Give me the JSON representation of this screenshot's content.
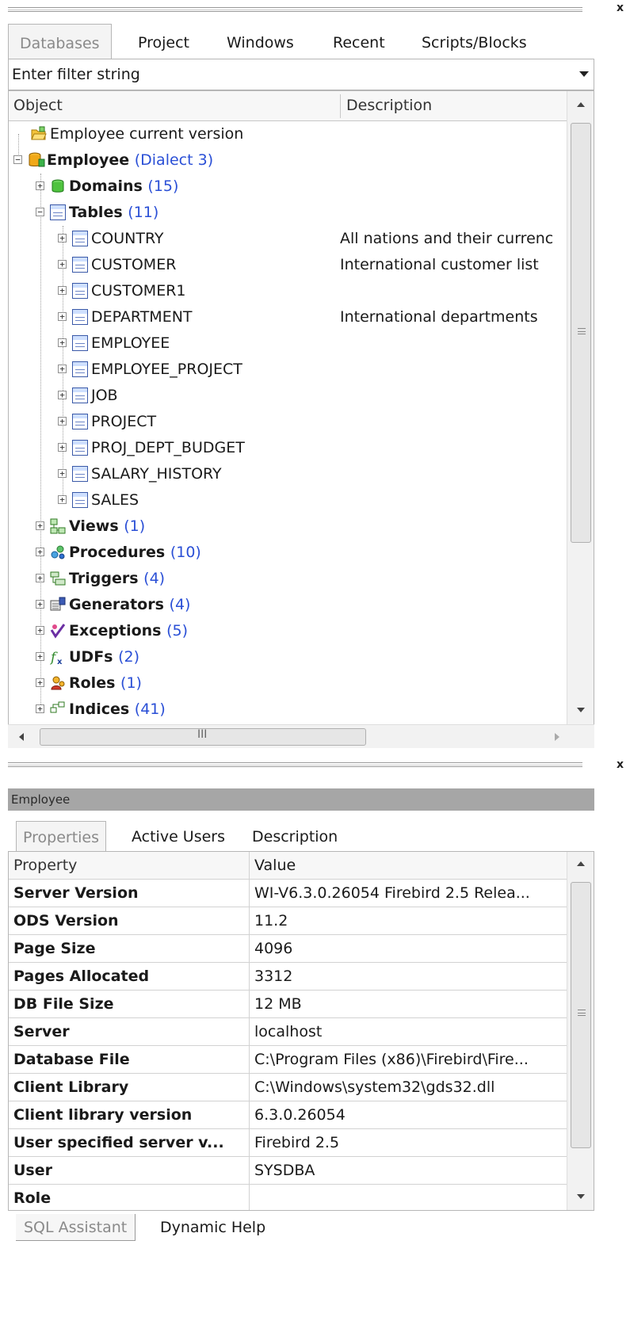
{
  "browser_tabs": [
    {
      "label": "Databases",
      "active": true
    },
    {
      "label": "Project",
      "active": false
    },
    {
      "label": "Windows",
      "active": false
    },
    {
      "label": "Recent",
      "active": false
    },
    {
      "label": "Scripts/Blocks",
      "active": false
    }
  ],
  "filter": {
    "placeholder": "Enter filter string"
  },
  "tree_header": {
    "object": "Object",
    "description": "Description"
  },
  "tree": {
    "current_version": "Employee current version",
    "database": {
      "name": "Employee",
      "dialect": "(Dialect 3)"
    },
    "domains": {
      "label": "Domains",
      "count": "(15)"
    },
    "tables": {
      "label": "Tables",
      "count": "(11)"
    },
    "table_items": [
      {
        "name": "COUNTRY",
        "description": "All nations and their currenc"
      },
      {
        "name": "CUSTOMER",
        "description": "International customer list"
      },
      {
        "name": "CUSTOMER1",
        "description": ""
      },
      {
        "name": "DEPARTMENT",
        "description": "International departments"
      },
      {
        "name": "EMPLOYEE",
        "description": ""
      },
      {
        "name": "EMPLOYEE_PROJECT",
        "description": ""
      },
      {
        "name": "JOB",
        "description": ""
      },
      {
        "name": "PROJECT",
        "description": ""
      },
      {
        "name": "PROJ_DEPT_BUDGET",
        "description": ""
      },
      {
        "name": "SALARY_HISTORY",
        "description": ""
      },
      {
        "name": "SALES",
        "description": ""
      }
    ],
    "groups": [
      {
        "label": "Views",
        "count": "(1)",
        "icon": "views-icon"
      },
      {
        "label": "Procedures",
        "count": "(10)",
        "icon": "procedures-icon"
      },
      {
        "label": "Triggers",
        "count": "(4)",
        "icon": "triggers-icon"
      },
      {
        "label": "Generators",
        "count": "(4)",
        "icon": "generators-icon"
      },
      {
        "label": "Exceptions",
        "count": "(5)",
        "icon": "exceptions-icon"
      },
      {
        "label": "UDFs",
        "count": "(2)",
        "icon": "udfs-icon"
      },
      {
        "label": "Roles",
        "count": "(1)",
        "icon": "roles-icon"
      },
      {
        "label": "Indices",
        "count": "(41)",
        "icon": "indices-icon"
      }
    ]
  },
  "hscroll_grip": "III",
  "close_glyph": "x",
  "details": {
    "title": "Employee",
    "tabs": [
      {
        "label": "Properties",
        "active": true
      },
      {
        "label": "Active Users",
        "active": false
      },
      {
        "label": "Description",
        "active": false
      }
    ],
    "header": {
      "property": "Property",
      "value": "Value"
    },
    "rows": [
      {
        "property": "Server Version",
        "value": "WI-V6.3.0.26054 Firebird 2.5 Relea..."
      },
      {
        "property": "ODS Version",
        "value": "11.2"
      },
      {
        "property": "Page Size",
        "value": "4096"
      },
      {
        "property": "Pages Allocated",
        "value": "3312"
      },
      {
        "property": "DB File Size",
        "value": "12 MB"
      },
      {
        "property": "Server",
        "value": "localhost"
      },
      {
        "property": "Database File",
        "value": "C:\\Program Files (x86)\\Firebird\\Fire..."
      },
      {
        "property": "Client Library",
        "value": "C:\\Windows\\system32\\gds32.dll"
      },
      {
        "property": "Client library version",
        "value": "6.3.0.26054"
      },
      {
        "property": "User specified server v...",
        "value": "Firebird 2.5"
      },
      {
        "property": "User",
        "value": "SYSDBA"
      },
      {
        "property": "Role",
        "value": ""
      }
    ]
  },
  "bottom_tabs": [
    {
      "label": "SQL Assistant",
      "active": true
    },
    {
      "label": "Dynamic Help",
      "active": false
    }
  ],
  "colors": {
    "count": "#2a4fd6",
    "title_bar": "#a6a6a6",
    "tab_inactive_text": "#8a8a8a"
  }
}
